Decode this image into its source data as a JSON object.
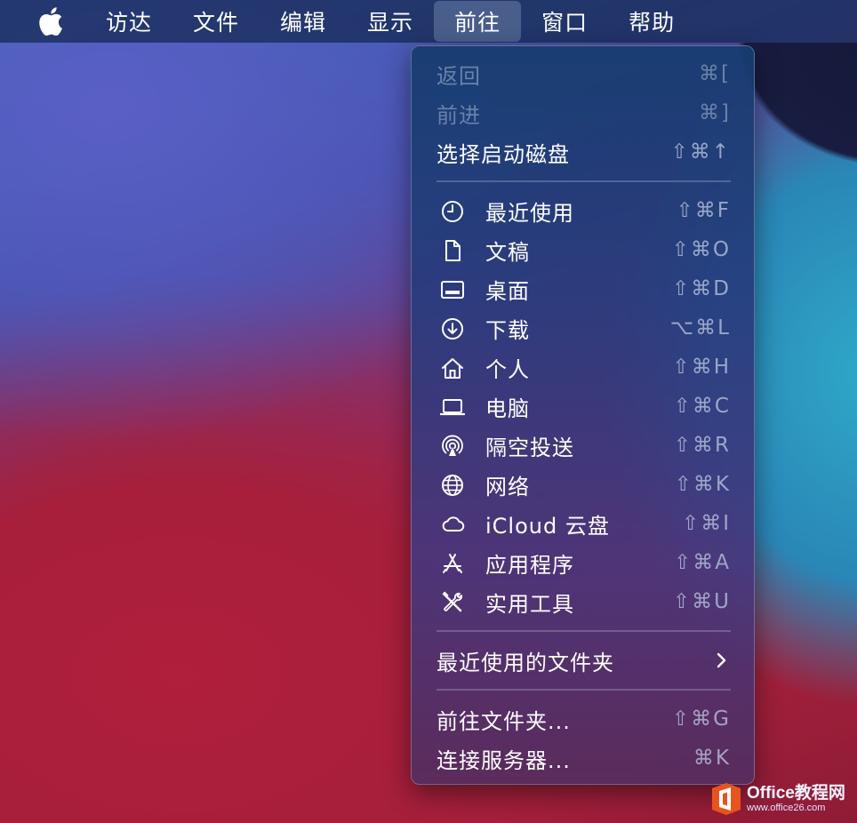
{
  "menubar": {
    "apple_icon": "apple-logo-icon",
    "items": [
      {
        "label": "访达"
      },
      {
        "label": "文件"
      },
      {
        "label": "编辑"
      },
      {
        "label": "显示"
      },
      {
        "label": "前往",
        "active": true
      },
      {
        "label": "窗口"
      },
      {
        "label": "帮助"
      }
    ]
  },
  "go_menu": {
    "items": [
      {
        "label": "返回",
        "shortcut": "⌘[",
        "disabled": true
      },
      {
        "label": "前进",
        "shortcut": "⌘]",
        "disabled": true
      },
      {
        "label": "选择启动磁盘",
        "shortcut": "⇧⌘↑"
      },
      {
        "label": "最近使用",
        "shortcut": "⇧⌘F",
        "icon": "clock-icon"
      },
      {
        "label": "文稿",
        "shortcut": "⇧⌘O",
        "icon": "document-icon"
      },
      {
        "label": "桌面",
        "shortcut": "⇧⌘D",
        "icon": "desktop-icon"
      },
      {
        "label": "下载",
        "shortcut": "⌥⌘L",
        "icon": "download-icon"
      },
      {
        "label": "个人",
        "shortcut": "⇧⌘H",
        "icon": "home-icon"
      },
      {
        "label": "电脑",
        "shortcut": "⇧⌘C",
        "icon": "laptop-icon"
      },
      {
        "label": "隔空投送",
        "shortcut": "⇧⌘R",
        "icon": "airdrop-icon"
      },
      {
        "label": "网络",
        "shortcut": "⇧⌘K",
        "icon": "globe-icon"
      },
      {
        "label": "iCloud 云盘",
        "shortcut": "⇧⌘I",
        "icon": "cloud-icon"
      },
      {
        "label": "应用程序",
        "shortcut": "⇧⌘A",
        "icon": "applications-icon"
      },
      {
        "label": "实用工具",
        "shortcut": "⇧⌘U",
        "icon": "utilities-icon"
      },
      {
        "label": "最近使用的文件夹",
        "submenu_icon": "chevron-right-icon"
      },
      {
        "label": "前往文件夹...",
        "shortcut": "⇧⌘G"
      },
      {
        "label": "连接服务器...",
        "shortcut": "⌘K"
      }
    ]
  },
  "watermark": {
    "title": "Office教程网",
    "url": "www.office26.com",
    "logo_icon": "office-logo-icon"
  }
}
